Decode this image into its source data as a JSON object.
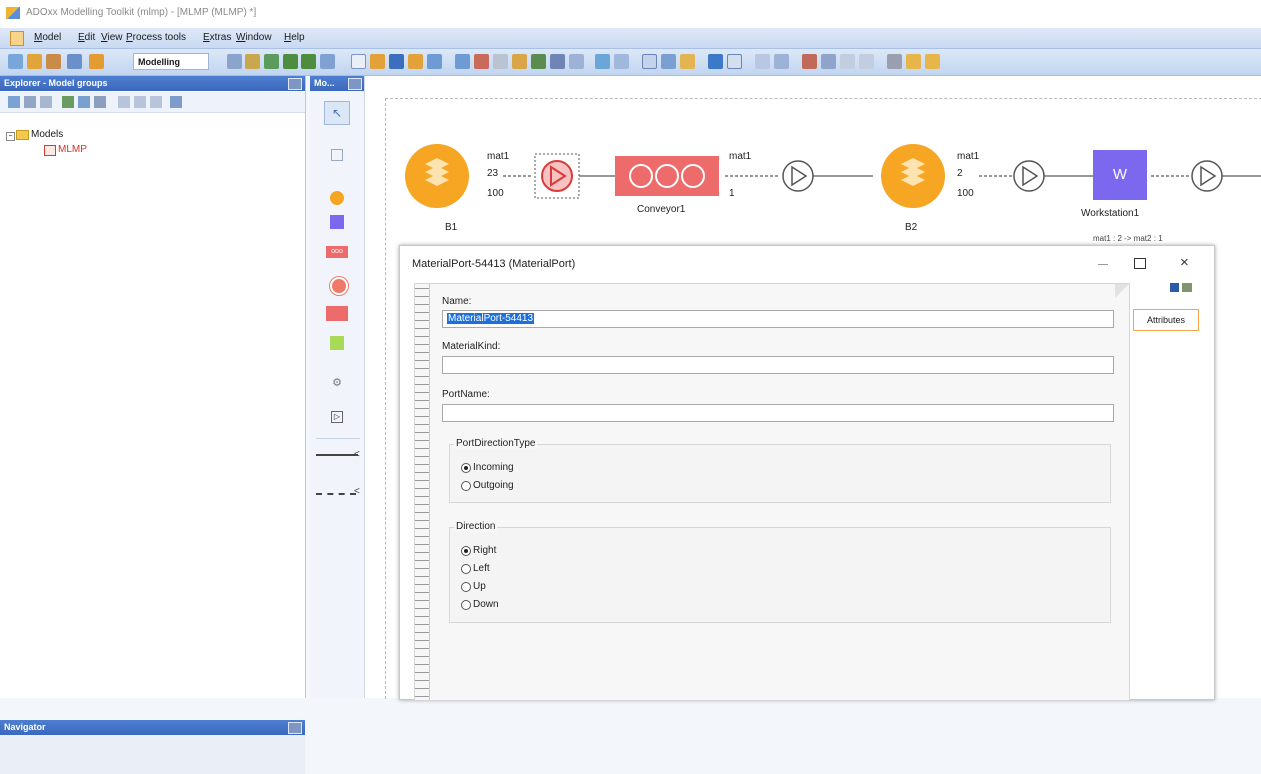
{
  "window": {
    "title": "ADOxx Modelling Toolkit (mlmp) - [MLMP (MLMP) *]"
  },
  "menu": [
    "Model",
    "Edit",
    "View",
    "Process tools",
    "Extras",
    "Window",
    "Help"
  ],
  "toolbar": {
    "mode": "Modelling"
  },
  "explorer": {
    "title": "Explorer - Model groups",
    "tree": {
      "root": "Models",
      "child": "MLMP"
    }
  },
  "navigator": {
    "title": "Navigator"
  },
  "modelling_bar": {
    "title": "Mo..."
  },
  "canvas": {
    "b1": {
      "label": "B1",
      "material": "mat1",
      "count": "23",
      "capacity": "100"
    },
    "conveyor": {
      "label": "Conveyor1",
      "material": "mat1",
      "count": "1"
    },
    "b2": {
      "label": "B2",
      "material": "mat1",
      "count": "2",
      "capacity": "100"
    },
    "workstation": {
      "label": "Workstation1",
      "glyph": "W",
      "recipe": "mat1 : 2 -> mat2 : 1"
    }
  },
  "dialog": {
    "title": "MaterialPort-54413 (MaterialPort)",
    "name_label": "Name:",
    "name_value": "MaterialPort-54413",
    "materialkind_label": "MaterialKind:",
    "materialkind_value": "",
    "portname_label": "PortName:",
    "portname_value": "",
    "portdirection": {
      "title": "PortDirectionType",
      "options": [
        "Incoming",
        "Outgoing"
      ],
      "selected": "Incoming"
    },
    "direction": {
      "title": "Direction",
      "options": [
        "Right",
        "Left",
        "Up",
        "Down"
      ],
      "selected": "Right"
    },
    "attributes_tab": "Attributes"
  }
}
